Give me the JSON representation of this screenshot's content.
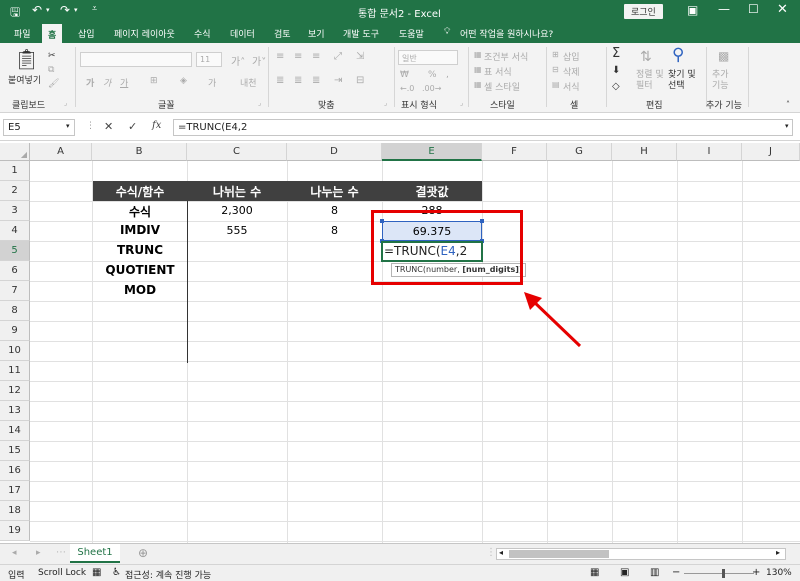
{
  "titlebar": {
    "title": "통합 문서2  -  Excel",
    "login": "로그인",
    "save_icon": "save-icon",
    "undo_icon": "undo-icon",
    "redo_icon": "redo-icon"
  },
  "tabs": [
    "파일",
    "홈",
    "삽입",
    "페이지 레이아웃",
    "수식",
    "데이터",
    "검토",
    "보기",
    "개발 도구",
    "도움말"
  ],
  "tell_me": "어떤 작업을 원하시나요?",
  "ribbon": {
    "paste_label": "붙여넣기",
    "groups": [
      "클립보드",
      "글꼴",
      "맞춤",
      "표시 형식",
      "스타일",
      "셀",
      "편집",
      "추가 기능"
    ],
    "font_size": "11",
    "number_format": "일반",
    "style_items": [
      "조건부 서식",
      "표 서식",
      "셀 스타일"
    ],
    "cell_items": [
      "삽입",
      "삭제",
      "서식"
    ],
    "sort_filter": "정렬 및 필터",
    "find_select": "찾기 및 선택",
    "addins": "추가 기능"
  },
  "formula_bar": {
    "name_box": "E5",
    "fx": "fx",
    "formula": "=TRUNC(E4,2"
  },
  "columns": [
    "A",
    "B",
    "C",
    "D",
    "E",
    "F",
    "G",
    "H",
    "I",
    "J"
  ],
  "rows": [
    "1",
    "2",
    "3",
    "4",
    "5",
    "6",
    "7",
    "8",
    "9",
    "10",
    "11",
    "12",
    "13",
    "14",
    "15",
    "16",
    "17",
    "18",
    "19"
  ],
  "table": {
    "headers": [
      "수식/함수",
      "나뉘는 수",
      "나누는 수",
      "결괏값"
    ],
    "labels": [
      "수식",
      "IMDIV",
      "TRUNC",
      "QUOTIENT",
      "MOD"
    ],
    "r3": [
      "2,300",
      "8",
      "288"
    ],
    "r4": [
      "555",
      "8",
      "69.375"
    ]
  },
  "edit": {
    "prefix": "=TRUNC(",
    "ref": "E4",
    "suffix": ",2",
    "tooltip_fn": "TRUNC(number, ",
    "tooltip_arg": "[num_digits]",
    "tooltip_end": ")"
  },
  "sheet_tab": "Sheet1",
  "status": {
    "mode": "입력",
    "scroll_lock": "Scroll Lock",
    "accessibility": "접근성: 계속 진행 가능",
    "zoom": "130%"
  },
  "colors": {
    "accent": "#217346",
    "header_fill": "#404040",
    "highlight": "#e60000",
    "ref_blue": "#2f63c0"
  }
}
